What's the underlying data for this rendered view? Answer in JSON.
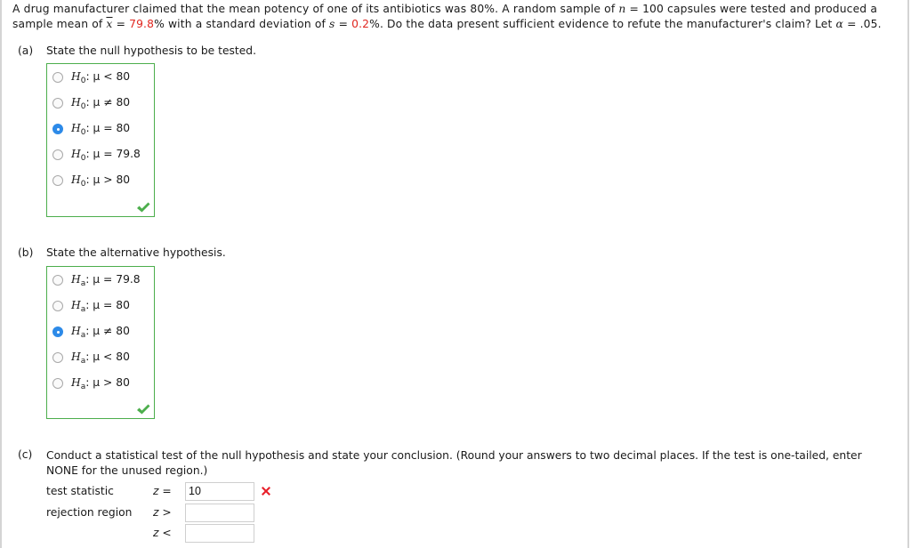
{
  "problem": {
    "line1_a": "A drug manufacturer claimed that the mean potency of one of its antibiotics was 80%. A random sample of ",
    "n_symbol": "n",
    "n_eq": " = ",
    "n_value": "100",
    "line1_b": " capsules were tested and produced a",
    "line2_a": "sample mean of ",
    "xbar_symbol": "x",
    "xbar_eq": " = ",
    "xbar_value": "79.8",
    "line2_b": "% with a standard deviation of ",
    "s_symbol": "s",
    "s_eq": " = ",
    "s_value": "0.2",
    "line2_c": "%. Do the data present sufficient evidence to refute the manufacturer's claim? Let ",
    "alpha_symbol": "α",
    "alpha_eq": " = .05."
  },
  "part_a": {
    "label": "(a)",
    "prompt": "State the null hypothesis to be tested.",
    "options": [
      {
        "h": "H",
        "sub": "0",
        "rel": ": μ < 80",
        "selected": false
      },
      {
        "h": "H",
        "sub": "0",
        "rel": ": μ ≠ 80",
        "selected": false
      },
      {
        "h": "H",
        "sub": "0",
        "rel": ": μ = 80",
        "selected": true
      },
      {
        "h": "H",
        "sub": "0",
        "rel": ": μ = 79.8",
        "selected": false
      },
      {
        "h": "H",
        "sub": "0",
        "rel": ": μ > 80",
        "selected": false
      }
    ],
    "status": "correct",
    "status_color": "#4cae4c"
  },
  "part_b": {
    "label": "(b)",
    "prompt": "State the alternative hypothesis.",
    "options": [
      {
        "h": "H",
        "sub": "a",
        "rel": ": μ = 79.8",
        "selected": false
      },
      {
        "h": "H",
        "sub": "a",
        "rel": ": μ = 80",
        "selected": false
      },
      {
        "h": "H",
        "sub": "a",
        "rel": ": μ ≠ 80",
        "selected": true
      },
      {
        "h": "H",
        "sub": "a",
        "rel": ": μ < 80",
        "selected": false
      },
      {
        "h": "H",
        "sub": "a",
        "rel": ": μ > 80",
        "selected": false
      }
    ],
    "status": "correct",
    "status_color": "#4cae4c"
  },
  "part_c": {
    "label": "(c)",
    "prompt_line1": "Conduct a statistical test of the null hypothesis and state your conclusion. (Round your answers to two decimal places. If the test is one-tailed, enter",
    "prompt_line2": "NONE for the unused region.)",
    "test_statistic": {
      "label": "test statistic",
      "var": "z",
      "op": " = ",
      "value": "10",
      "status": "incorrect",
      "status_color": "#e8202a"
    },
    "rejection_upper": {
      "label": "rejection region",
      "var": "z",
      "op": " > ",
      "value": ""
    },
    "rejection_lower": {
      "label": "",
      "var": "z",
      "op": " < ",
      "value": ""
    }
  }
}
